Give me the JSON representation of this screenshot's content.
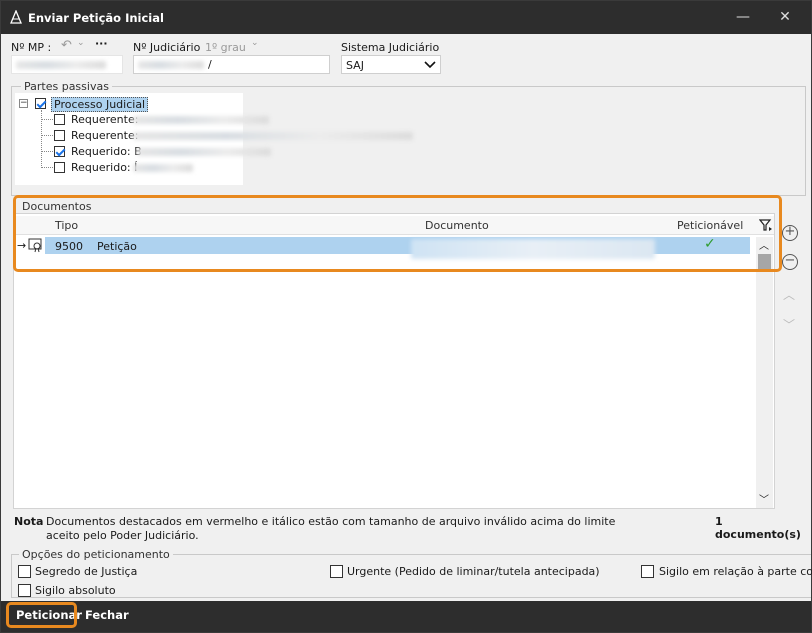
{
  "window": {
    "title": "Enviar Petição Inicial"
  },
  "header": {
    "mp_label": "Nº MP :",
    "judicial_label": "Nº Judiciário",
    "grau_label": "1º grau",
    "sistema_label": "Sistema Judiciário",
    "sistema_value": "SAJ",
    "judicial_value_suffix": "/"
  },
  "partes": {
    "title": "Partes passivas",
    "root_label": "Processo Judicial",
    "items": [
      {
        "label": "Requerente:",
        "checked": false
      },
      {
        "label": "Requerente:",
        "checked": false
      },
      {
        "label": "Requerido: B",
        "checked": true
      },
      {
        "label": "Requerido: Í",
        "checked": false
      }
    ]
  },
  "documentos": {
    "title": "Documentos",
    "columns": {
      "tipo": "Tipo",
      "documento": "Documento",
      "peticionavel": "Peticionável"
    },
    "rows": [
      {
        "codigo": "9500",
        "tipo": "Petição",
        "peticionavel": "✓"
      }
    ]
  },
  "nota": {
    "label": "Nota",
    "text": "Documentos  destacados em vermelho e itálico estão com tamanho de arquivo inválido acima do limite aceito pelo Poder Judiciário.",
    "count": "1 documento(s)"
  },
  "opcoes": {
    "title": "Opções do peticionamento",
    "segredo": "Segredo de Justiça",
    "urgente": "Urgente (Pedido de liminar/tutela antecipada)",
    "sigilo_parte": "Sigilo em relação à parte con",
    "sigilo_absoluto": "Sigilo absoluto"
  },
  "footer": {
    "peticionar": "Peticionar",
    "fechar": "Fechar"
  },
  "colors": {
    "accent_orange": "#e8891f",
    "selection": "#aed2ef",
    "check_green": "#2e9c2e"
  }
}
